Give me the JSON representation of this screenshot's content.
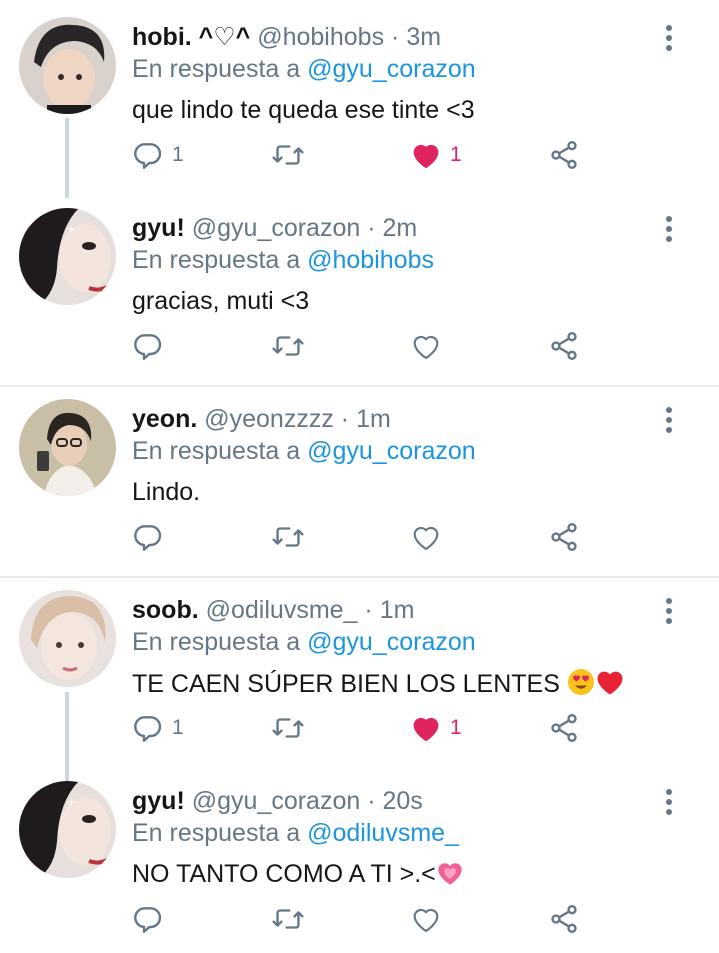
{
  "colors": {
    "text": "#14171a",
    "secondary": "#657786",
    "mention": "#1b95e0",
    "like": "#e0245e",
    "divider": "#e6ecf0",
    "thread_line": "#ccd6dd"
  },
  "tweets": [
    {
      "name": "hobi. ^♡^",
      "handle": "@hobihobs",
      "dot": "·",
      "time": "3m",
      "reply_prefix": "En respuesta a",
      "reply_to": "@gyu_corazon",
      "text": "que lindo te queda ese tinte <3",
      "reply_count": "1",
      "retweet_count": "",
      "like_count": "1",
      "liked": true
    },
    {
      "name": "gyu!",
      "handle": "@gyu_corazon",
      "dot": "·",
      "time": "2m",
      "reply_prefix": "En respuesta a",
      "reply_to": "@hobihobs",
      "text": "gracias, muti <3",
      "reply_count": "",
      "retweet_count": "",
      "like_count": "",
      "liked": false
    },
    {
      "name": "yeon.",
      "handle": "@yeonzzzz",
      "dot": "·",
      "time": "1m",
      "reply_prefix": "En respuesta a",
      "reply_to": "@gyu_corazon",
      "text": "Lindo.",
      "reply_count": "",
      "retweet_count": "",
      "like_count": "",
      "liked": false
    },
    {
      "name": "soob.",
      "handle": "@odiluvsme_",
      "dot": "·",
      "time": "1m",
      "reply_prefix": "En respuesta a",
      "reply_to": "@gyu_corazon",
      "text": "TE CAEN SÚPER BIEN LOS LENTES",
      "text_emojis": [
        "heart-eyes-emoji",
        "red-heart-emoji"
      ],
      "reply_count": "1",
      "retweet_count": "",
      "like_count": "1",
      "liked": true
    },
    {
      "name": "gyu!",
      "handle": "@gyu_corazon",
      "dot": "·",
      "time": "20s",
      "reply_prefix": "En respuesta a",
      "reply_to": "@odiluvsme_",
      "text": "NO TANTO COMO A TI >.<",
      "text_emojis": [
        "sparkling-heart-emoji"
      ],
      "reply_count": "",
      "retweet_count": "",
      "like_count": "",
      "liked": false
    }
  ],
  "icons": {
    "more": "more-vertical-icon",
    "reply": "reply-icon",
    "retweet": "retweet-icon",
    "like": "heart-icon",
    "share": "share-icon"
  }
}
